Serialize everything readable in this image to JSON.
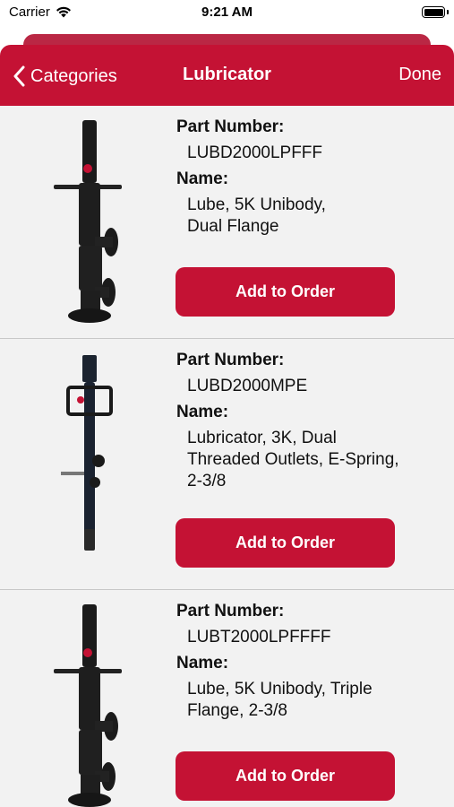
{
  "status_bar": {
    "carrier": "Carrier",
    "time": "9:21 AM"
  },
  "nav": {
    "back_label": "Categories",
    "title": "Lubricator",
    "done_label": "Done"
  },
  "theme": {
    "accent": "#c41234",
    "background": "#f2f2f2"
  },
  "products": [
    {
      "part_label": "Part Number:",
      "part_number": "LUBD2000LPFFF",
      "name_label": "Name:",
      "name": "Lube, 5K Unibody,\nDual Flange",
      "button_label": "Add to Order",
      "image_icon": "lubricator-5k-dual-flange-image"
    },
    {
      "part_label": "Part Number:",
      "part_number": "LUBD2000MPE",
      "name_label": "Name:",
      "name": "Lubricator, 3K, Dual\nThreaded Outlets, E-Spring,\n2-3/8",
      "button_label": "Add to Order",
      "image_icon": "lubricator-3k-threaded-image"
    },
    {
      "part_label": "Part Number:",
      "part_number": "LUBT2000LPFFFF",
      "name_label": "Name:",
      "name": "Lube, 5K Unibody, Triple\nFlange, 2-3/8",
      "button_label": "Add to Order",
      "image_icon": "lubricator-5k-triple-flange-image"
    }
  ]
}
